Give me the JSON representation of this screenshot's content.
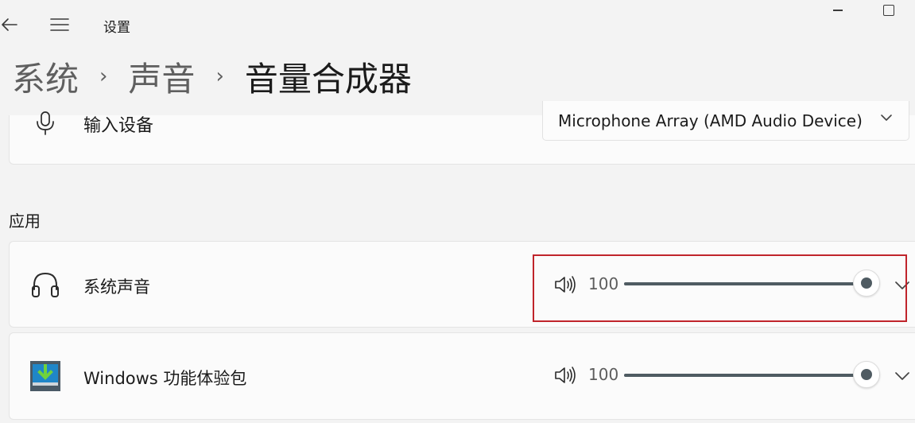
{
  "window": {
    "title": "设置",
    "back_icon": "back-arrow-icon",
    "menu_icon": "hamburger-menu-icon"
  },
  "breadcrumb": {
    "items": [
      "系统",
      "声音"
    ],
    "separator": "›",
    "current": "音量合成器"
  },
  "input_device": {
    "label": "输入设备",
    "icon": "microphone-icon",
    "selected": "Microphone Array (AMD Audio Device)"
  },
  "apps_section": {
    "title": "应用",
    "apps": [
      {
        "name": "系统声音",
        "icon": "headphones-icon",
        "volume": "100",
        "volume_level": 100
      },
      {
        "name": "Windows 功能体验包",
        "icon": "windows-feature-pack-icon",
        "volume": "100",
        "volume_level": 100
      }
    ]
  },
  "colors": {
    "accent": "#4f5b62",
    "highlight_border": "#c0242b",
    "background": "#f3f3f3",
    "card": "#fbfbfb"
  }
}
